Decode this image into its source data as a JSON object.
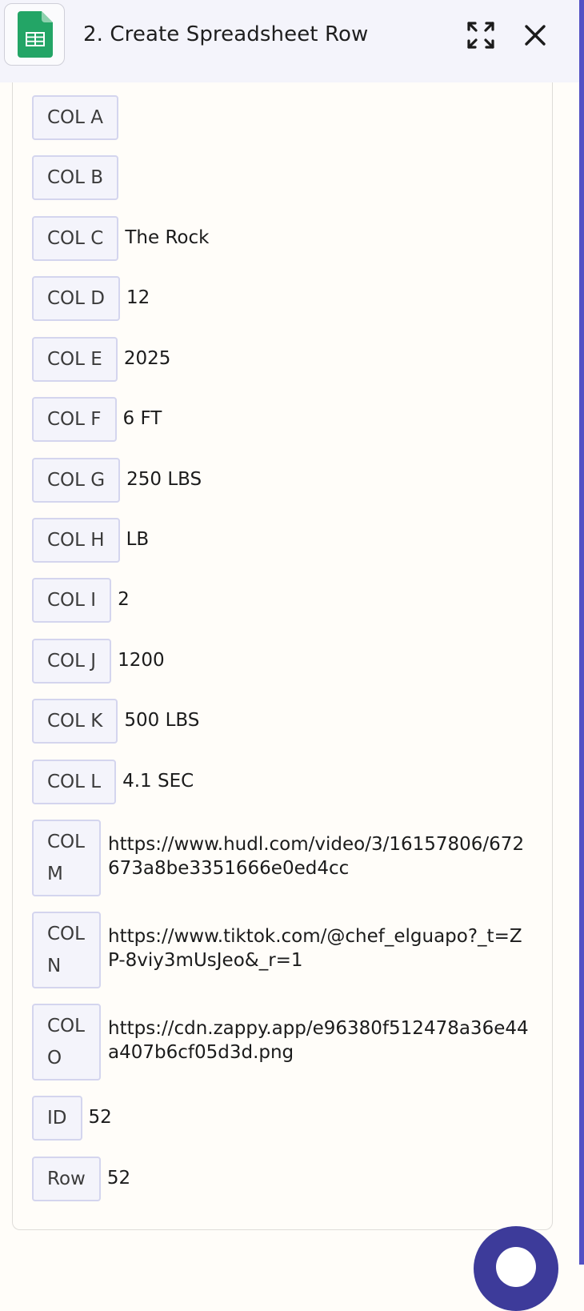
{
  "header": {
    "title": "2. Create Spreadsheet Row",
    "app_icon": "google-sheets-icon",
    "expand_icon": "expand-icon",
    "close_icon": "close-icon"
  },
  "colors": {
    "header_bg": "#f4f4fb",
    "key_bg": "#f4f4fb",
    "key_border": "#d4d5ee",
    "sheets_green": "#23a566",
    "accent": "#3d3b9a"
  },
  "fields": [
    {
      "key": "COL A",
      "value": ""
    },
    {
      "key": "COL B",
      "value": ""
    },
    {
      "key": "COL C",
      "value": "The Rock"
    },
    {
      "key": "COL D",
      "value": "12"
    },
    {
      "key": "COL E",
      "value": "2025"
    },
    {
      "key": "COL F",
      "value": "6 FT"
    },
    {
      "key": "COL G",
      "value": "250 LBS"
    },
    {
      "key": "COL H",
      "value": "LB"
    },
    {
      "key": "COL I",
      "value": "2"
    },
    {
      "key": "COL J",
      "value": "1200"
    },
    {
      "key": "COL K",
      "value": "500 LBS"
    },
    {
      "key": "COL L",
      "value": "4.1 SEC"
    },
    {
      "key": "COL M",
      "value": "https://www.hudl.com/video/3/16157806/672673a8be3351666e0ed4cc"
    },
    {
      "key": "COL N",
      "value": "https://www.tiktok.com/@chef_elguapo?_t=ZP-8viy3mUsJeo&_r=1"
    },
    {
      "key": "COL O",
      "value": "https://cdn.zappy.app/e96380f512478a36e44a407b6cf05d3d.png"
    },
    {
      "key": "ID",
      "value": "52"
    },
    {
      "key": "Row",
      "value": "52"
    }
  ]
}
